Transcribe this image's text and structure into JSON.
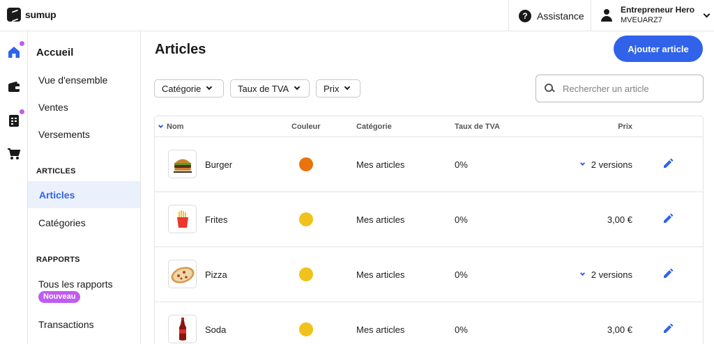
{
  "brand": {
    "name": "sumup",
    "accent": "#3063e9",
    "badge_color": "#c05bf0"
  },
  "header": {
    "assistance_label": "Assistance",
    "user_name": "Entrepreneur Hero",
    "user_id": "MVEUARZ7"
  },
  "rail": {
    "icons": [
      "home-icon",
      "wallet-icon",
      "invoice-icon",
      "cart-icon"
    ]
  },
  "sidebar": {
    "title": "Accueil",
    "links": [
      "Vue d'ensemble",
      "Ventes",
      "Versements"
    ],
    "section_articles": "ARTICLES",
    "articles_active": "Articles",
    "articles_categories": "Catégories",
    "section_rapports": "RAPPORTS",
    "rapports_all": "Tous les rapports",
    "rapports_badge": "Nouveau",
    "rapports_transactions": "Transactions"
  },
  "main": {
    "title": "Articles",
    "add_button": "Ajouter article",
    "filters": [
      "Catégorie",
      "Taux de TVA",
      "Prix"
    ],
    "search_placeholder": "Rechercher un article"
  },
  "table": {
    "columns": {
      "nom": "Nom",
      "couleur": "Couleur",
      "categorie": "Catégorie",
      "tva": "Taux de TVA",
      "prix": "Prix"
    },
    "rows": [
      {
        "name": "Burger",
        "color": "#e9730c",
        "category": "Mes articles",
        "tva": "0%",
        "price": "2 versions",
        "expandable": true,
        "icon": "burger-image"
      },
      {
        "name": "Frites",
        "color": "#f1c21b",
        "category": "Mes articles",
        "tva": "0%",
        "price": "3,00 €",
        "expandable": false,
        "icon": "fries-image"
      },
      {
        "name": "Pizza",
        "color": "#f1c21b",
        "category": "Mes articles",
        "tva": "0%",
        "price": "2 versions",
        "expandable": true,
        "icon": "pizza-image"
      },
      {
        "name": "Soda",
        "color": "#f1c21b",
        "category": "Mes articles",
        "tva": "0%",
        "price": "3,00 €",
        "expandable": false,
        "icon": "soda-image"
      }
    ]
  }
}
